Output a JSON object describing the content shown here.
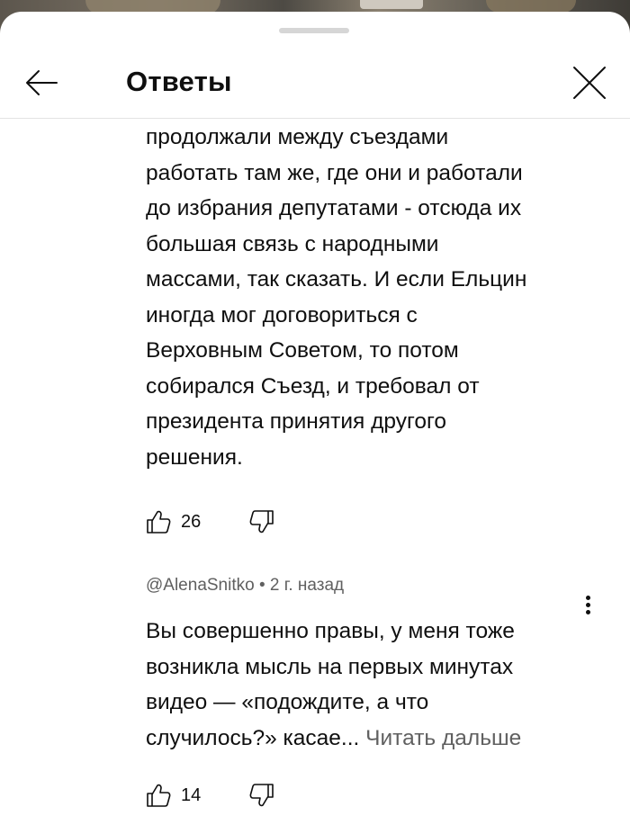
{
  "header": {
    "title": "Ответы"
  },
  "comments": [
    {
      "lines": [
        "продолжали между съездами",
        "работать там же, где они и работали",
        "до избрания депутатами - отсюда их",
        "большая связь с народными",
        "массами, так сказать. И если Ельцин",
        "иногда мог договориться с",
        "Верховным Советом, то потом",
        "собирался Съезд, и требовал от",
        "президента принятия другого",
        "решения."
      ],
      "likes": "26"
    },
    {
      "author": "@AlenaSnitko",
      "separator": "•",
      "time": "2 г. назад",
      "lines": [
        "Вы совершенно правы, у меня тоже",
        "возникла мысль на первых минутах",
        "видео — «подождите, а что"
      ],
      "last_line": "случилось?» касае...",
      "read_more": "Читать дальше",
      "likes": "14"
    }
  ],
  "icons": {
    "back": "arrow-left-icon",
    "close": "close-icon",
    "like": "thumbs-up-icon",
    "dislike": "thumbs-down-icon",
    "more": "more-vertical-icon"
  },
  "colors": {
    "text": "#0f0f0f",
    "secondary": "#606060",
    "divider": "#e3e3e3"
  }
}
